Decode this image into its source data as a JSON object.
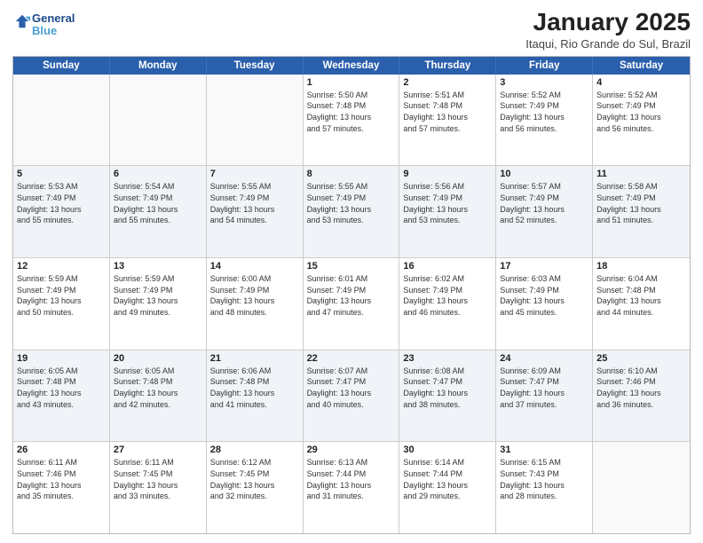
{
  "header": {
    "logo_line1": "General",
    "logo_line2": "Blue",
    "month_title": "January 2025",
    "location": "Itaqui, Rio Grande do Sul, Brazil"
  },
  "weekdays": [
    "Sunday",
    "Monday",
    "Tuesday",
    "Wednesday",
    "Thursday",
    "Friday",
    "Saturday"
  ],
  "rows": [
    {
      "alt": false,
      "cells": [
        {
          "day": "",
          "info": ""
        },
        {
          "day": "",
          "info": ""
        },
        {
          "day": "",
          "info": ""
        },
        {
          "day": "1",
          "info": "Sunrise: 5:50 AM\nSunset: 7:48 PM\nDaylight: 13 hours\nand 57 minutes."
        },
        {
          "day": "2",
          "info": "Sunrise: 5:51 AM\nSunset: 7:48 PM\nDaylight: 13 hours\nand 57 minutes."
        },
        {
          "day": "3",
          "info": "Sunrise: 5:52 AM\nSunset: 7:49 PM\nDaylight: 13 hours\nand 56 minutes."
        },
        {
          "day": "4",
          "info": "Sunrise: 5:52 AM\nSunset: 7:49 PM\nDaylight: 13 hours\nand 56 minutes."
        }
      ]
    },
    {
      "alt": true,
      "cells": [
        {
          "day": "5",
          "info": "Sunrise: 5:53 AM\nSunset: 7:49 PM\nDaylight: 13 hours\nand 55 minutes."
        },
        {
          "day": "6",
          "info": "Sunrise: 5:54 AM\nSunset: 7:49 PM\nDaylight: 13 hours\nand 55 minutes."
        },
        {
          "day": "7",
          "info": "Sunrise: 5:55 AM\nSunset: 7:49 PM\nDaylight: 13 hours\nand 54 minutes."
        },
        {
          "day": "8",
          "info": "Sunrise: 5:55 AM\nSunset: 7:49 PM\nDaylight: 13 hours\nand 53 minutes."
        },
        {
          "day": "9",
          "info": "Sunrise: 5:56 AM\nSunset: 7:49 PM\nDaylight: 13 hours\nand 53 minutes."
        },
        {
          "day": "10",
          "info": "Sunrise: 5:57 AM\nSunset: 7:49 PM\nDaylight: 13 hours\nand 52 minutes."
        },
        {
          "day": "11",
          "info": "Sunrise: 5:58 AM\nSunset: 7:49 PM\nDaylight: 13 hours\nand 51 minutes."
        }
      ]
    },
    {
      "alt": false,
      "cells": [
        {
          "day": "12",
          "info": "Sunrise: 5:59 AM\nSunset: 7:49 PM\nDaylight: 13 hours\nand 50 minutes."
        },
        {
          "day": "13",
          "info": "Sunrise: 5:59 AM\nSunset: 7:49 PM\nDaylight: 13 hours\nand 49 minutes."
        },
        {
          "day": "14",
          "info": "Sunrise: 6:00 AM\nSunset: 7:49 PM\nDaylight: 13 hours\nand 48 minutes."
        },
        {
          "day": "15",
          "info": "Sunrise: 6:01 AM\nSunset: 7:49 PM\nDaylight: 13 hours\nand 47 minutes."
        },
        {
          "day": "16",
          "info": "Sunrise: 6:02 AM\nSunset: 7:49 PM\nDaylight: 13 hours\nand 46 minutes."
        },
        {
          "day": "17",
          "info": "Sunrise: 6:03 AM\nSunset: 7:49 PM\nDaylight: 13 hours\nand 45 minutes."
        },
        {
          "day": "18",
          "info": "Sunrise: 6:04 AM\nSunset: 7:48 PM\nDaylight: 13 hours\nand 44 minutes."
        }
      ]
    },
    {
      "alt": true,
      "cells": [
        {
          "day": "19",
          "info": "Sunrise: 6:05 AM\nSunset: 7:48 PM\nDaylight: 13 hours\nand 43 minutes."
        },
        {
          "day": "20",
          "info": "Sunrise: 6:05 AM\nSunset: 7:48 PM\nDaylight: 13 hours\nand 42 minutes."
        },
        {
          "day": "21",
          "info": "Sunrise: 6:06 AM\nSunset: 7:48 PM\nDaylight: 13 hours\nand 41 minutes."
        },
        {
          "day": "22",
          "info": "Sunrise: 6:07 AM\nSunset: 7:47 PM\nDaylight: 13 hours\nand 40 minutes."
        },
        {
          "day": "23",
          "info": "Sunrise: 6:08 AM\nSunset: 7:47 PM\nDaylight: 13 hours\nand 38 minutes."
        },
        {
          "day": "24",
          "info": "Sunrise: 6:09 AM\nSunset: 7:47 PM\nDaylight: 13 hours\nand 37 minutes."
        },
        {
          "day": "25",
          "info": "Sunrise: 6:10 AM\nSunset: 7:46 PM\nDaylight: 13 hours\nand 36 minutes."
        }
      ]
    },
    {
      "alt": false,
      "cells": [
        {
          "day": "26",
          "info": "Sunrise: 6:11 AM\nSunset: 7:46 PM\nDaylight: 13 hours\nand 35 minutes."
        },
        {
          "day": "27",
          "info": "Sunrise: 6:11 AM\nSunset: 7:45 PM\nDaylight: 13 hours\nand 33 minutes."
        },
        {
          "day": "28",
          "info": "Sunrise: 6:12 AM\nSunset: 7:45 PM\nDaylight: 13 hours\nand 32 minutes."
        },
        {
          "day": "29",
          "info": "Sunrise: 6:13 AM\nSunset: 7:44 PM\nDaylight: 13 hours\nand 31 minutes."
        },
        {
          "day": "30",
          "info": "Sunrise: 6:14 AM\nSunset: 7:44 PM\nDaylight: 13 hours\nand 29 minutes."
        },
        {
          "day": "31",
          "info": "Sunrise: 6:15 AM\nSunset: 7:43 PM\nDaylight: 13 hours\nand 28 minutes."
        },
        {
          "day": "",
          "info": ""
        }
      ]
    }
  ]
}
